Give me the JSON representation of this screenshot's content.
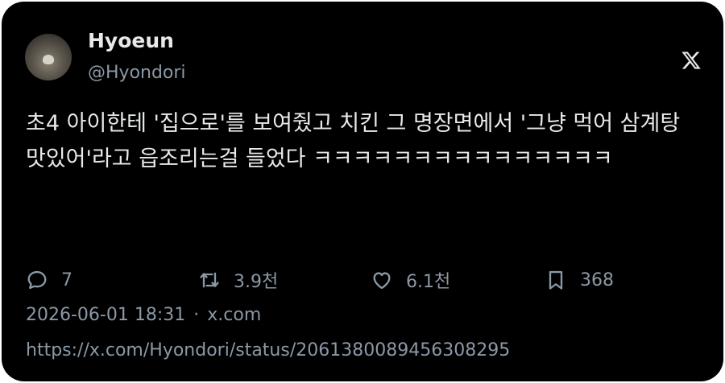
{
  "author": {
    "display_name": "Hyoeun",
    "handle": "@Hyondori"
  },
  "tweet": {
    "text": "초4 아이한테 '집으로'를 보여줬고 치킨 그 명장면에서 '그냥 먹어 삼계탕 맛있어'라고 읍조리는걸 들었다 ㅋㅋㅋㅋㅋㅋㅋㅋㅋㅋㅋㅋㅋㅋㅋ"
  },
  "actions": {
    "reply_count": "7",
    "retweet_count": "3.9천",
    "like_count": "6.1천",
    "bookmark_count": "368"
  },
  "meta": {
    "timestamp": "2026-06-01 18:31",
    "separator": "·",
    "source": "x.com",
    "url": "https://x.com/Hyondori/status/2061380089456308295"
  },
  "icons": {
    "platform_logo": "x-logo-icon",
    "reply": "speech-bubble-icon",
    "retweet": "retweet-icon",
    "like": "heart-icon",
    "bookmark": "bookmark-icon"
  }
}
